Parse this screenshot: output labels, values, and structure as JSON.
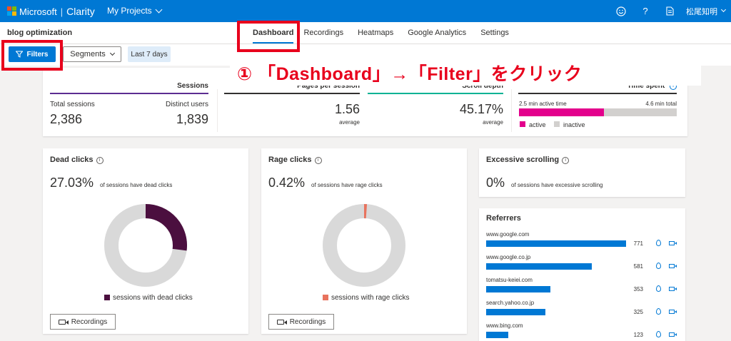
{
  "topbar": {
    "brand": "Microsoft",
    "product": "Clarity",
    "projects_label": "My Projects",
    "user_name": "松尾知明",
    "colors": {
      "bar": "#0078d4",
      "logo": [
        "#f25022",
        "#7fba00",
        "#00a4ef",
        "#ffb900"
      ]
    },
    "icons": [
      "smiley-icon",
      "help-icon",
      "document-icon"
    ]
  },
  "project": {
    "name": "blog optimization"
  },
  "nav": {
    "tabs": [
      {
        "label": "Dashboard",
        "active": true
      },
      {
        "label": "Recordings"
      },
      {
        "label": "Heatmaps"
      },
      {
        "label": "Google Analytics"
      },
      {
        "label": "Settings"
      }
    ]
  },
  "filters": {
    "filters_label": "Filters",
    "segments_label": "Segments",
    "date_label": "Last 7 days"
  },
  "annotation": {
    "text": "① 「Dashboard」→「Filter」をクリック",
    "color": "#e8001c"
  },
  "summary": {
    "sessions_header": "Sessions",
    "total_label": "Total sessions",
    "total_value": "2,386",
    "distinct_label": "Distinct users",
    "distinct_value": "1,839",
    "pages_header": "Pages per session",
    "pages_value": "1.56",
    "pages_sub": "average",
    "scroll_header": "Scroll depth",
    "scroll_value": "45.17%",
    "scroll_sub": "average",
    "time_header": "Time spent",
    "active_text": "2.5 min active time",
    "total_text": "4.6 min total",
    "active_fraction": 0.54,
    "legend_active": "active",
    "legend_inactive": "inactive",
    "colors": {
      "sessions": "#5c2d91",
      "scroll": "#00b294",
      "active": "#e3008c",
      "inactive": "#d2d0ce"
    }
  },
  "dead_clicks": {
    "title": "Dead clicks",
    "percent": "27.03%",
    "desc": "of sessions have dead clicks",
    "fraction": 0.2703,
    "legend": "sessions with dead clicks",
    "recordings_label": "Recordings",
    "color": "#4b0f3f"
  },
  "rage_clicks": {
    "title": "Rage clicks",
    "percent": "0.42%",
    "desc": "of sessions have rage clicks",
    "fraction": 0.0042,
    "legend": "sessions with rage clicks",
    "recordings_label": "Recordings",
    "color": "#e8735e"
  },
  "excessive_scrolling": {
    "title": "Excessive scrolling",
    "percent": "0%",
    "desc": "of sessions have excessive scrolling"
  },
  "referrers": {
    "title": "Referrers",
    "items": [
      {
        "url": "www.google.com",
        "count": "771",
        "value": 771
      },
      {
        "url": "www.google.co.jp",
        "count": "581",
        "value": 581
      },
      {
        "url": "tomatsu-keiei.com",
        "count": "353",
        "value": 353
      },
      {
        "url": "search.yahoo.co.jp",
        "count": "325",
        "value": 325
      },
      {
        "url": "www.bing.com",
        "count": "123",
        "value": 123
      }
    ]
  }
}
